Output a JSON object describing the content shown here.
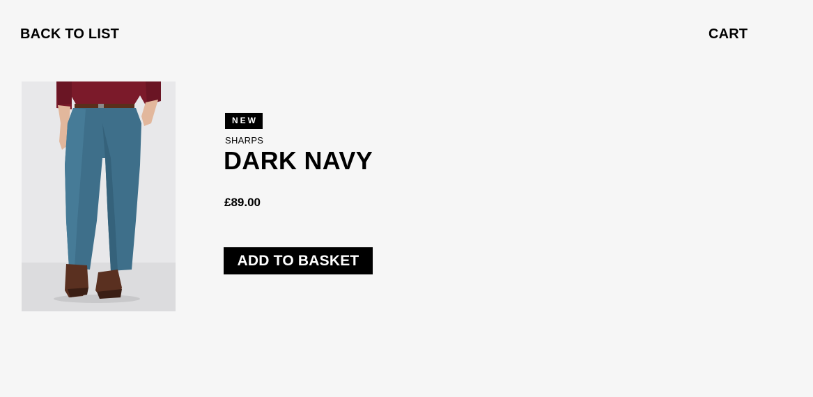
{
  "nav": {
    "back_label": "BACK TO LIST",
    "cart_label": "CART"
  },
  "product": {
    "badge": "NEW",
    "brand": "SHARPS",
    "name": "DARK NAVY",
    "price": "£89.00",
    "add_to_basket_label": "ADD TO BASKET"
  },
  "colors": {
    "page_background": "#f6f6f6",
    "text": "#000000",
    "button_background": "#000000",
    "button_text": "#ffffff",
    "trousers": "#3e6f8a",
    "sweater": "#7b1a2a"
  }
}
